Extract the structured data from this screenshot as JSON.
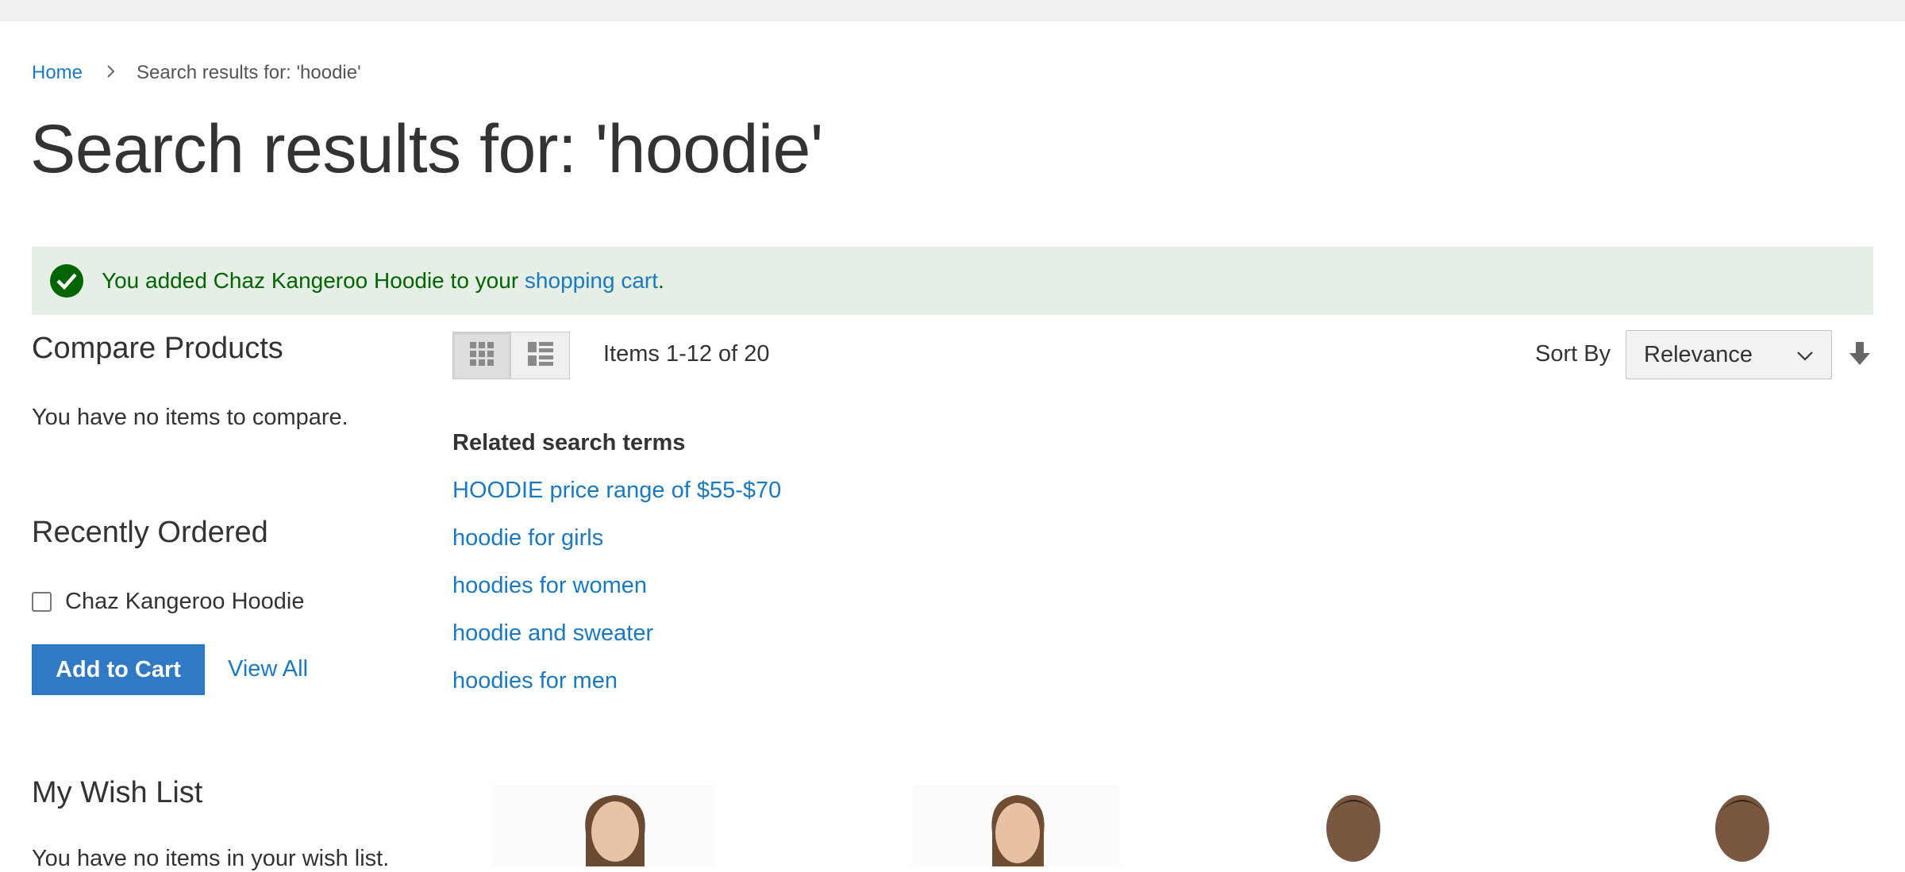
{
  "breadcrumb": {
    "home": "Home",
    "current": "Search results for: 'hoodie'"
  },
  "page_title": "Search results for: 'hoodie'",
  "message": {
    "prefix": "You added Chaz Kangeroo Hoodie to your ",
    "link": "shopping cart",
    "suffix": ".",
    "icon": "check-icon"
  },
  "sidebar": {
    "compare": {
      "title": "Compare Products",
      "empty": "You have no items to compare."
    },
    "recently_ordered": {
      "title": "Recently Ordered",
      "items": [
        {
          "label": "Chaz Kangeroo Hoodie",
          "checked": false
        }
      ],
      "add_to_cart": "Add to Cart",
      "view_all": "View All"
    },
    "wishlist": {
      "title": "My Wish List",
      "empty": "You have no items in your wish list."
    }
  },
  "toolbar": {
    "modes": [
      {
        "name": "grid",
        "icon": "grid-icon",
        "active": true
      },
      {
        "name": "list",
        "icon": "list-icon",
        "active": false
      }
    ],
    "amount": "Items 1-12 of 20",
    "sort_label": "Sort By",
    "sort_value": "Relevance",
    "sort_direction_icon": "arrow-down-icon"
  },
  "related": {
    "title": "Related search terms",
    "terms": [
      "HOODIE price range of $55-$70",
      "hoodie for girls",
      "hoodies for women",
      "hoodie and sweater",
      "hoodies for men"
    ]
  },
  "colors": {
    "link": "#1979c3",
    "success_bg": "#e5efe5",
    "success_text": "#006400",
    "primary_button": "#3079c4"
  }
}
